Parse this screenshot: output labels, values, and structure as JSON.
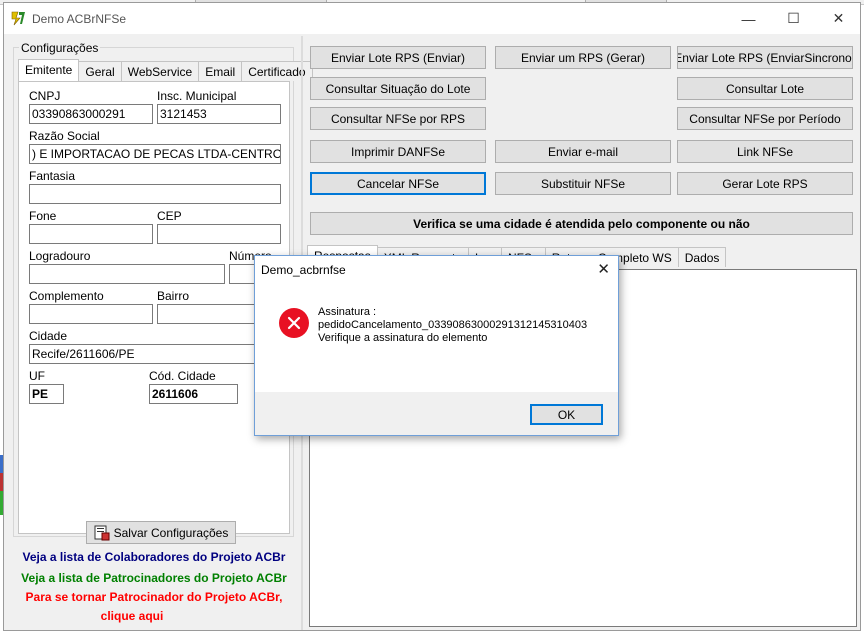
{
  "window": {
    "title": "Demo ACBrNFSe",
    "minimize_symbol": "—",
    "maximize_symbol": "☐",
    "close_symbol": "✕",
    "icon": "app-logo-icon"
  },
  "config": {
    "group_label": "Configurações",
    "tabs": [
      "Emitente",
      "Geral",
      "WebService",
      "Email",
      "Certificado"
    ],
    "active_tab": "Emitente",
    "fields": {
      "cnpj_label": "CNPJ",
      "cnpj_value": "03390863000291",
      "im_label": "Insc. Municipal",
      "im_value": "3121453",
      "razao_label": "Razão Social",
      "razao_value": ") E IMPORTACAO DE PECAS LTDA-CENTROCAR",
      "fantasia_label": "Fantasia",
      "fantasia_value": "",
      "fone_label": "Fone",
      "fone_value": "",
      "cep_label": "CEP",
      "cep_value": "",
      "logradouro_label": "Logradouro",
      "logradouro_value": "",
      "numero_label": "Número",
      "numero_value": "",
      "complemento_label": "Complemento",
      "complemento_value": "",
      "bairro_label": "Bairro",
      "bairro_value": "",
      "cidade_label": "Cidade",
      "cidade_value": "Recife/2611606/PE",
      "uf_label": "UF",
      "uf_value": "PE",
      "cod_cidade_label": "Cód. Cidade",
      "cod_cidade_value": "2611606"
    },
    "save_button": "Salvar Configurações",
    "save_icon": "save-config-icon"
  },
  "links": {
    "colaboradores": "Veja a lista de Colaboradores do Projeto ACBr",
    "patrocinadores": "Veja a lista de Patrocinadores do Projeto ACBr",
    "tornar_patrocinador_1": "Para se tornar Patrocinador do Projeto ACBr,",
    "tornar_patrocinador_2": "clique aqui",
    "colors": {
      "colaboradores": "#000080",
      "patrocinadores": "#008000",
      "tornar": "#ff0000"
    }
  },
  "actions": {
    "enviar_lote": "Enviar Lote RPS (Enviar)",
    "enviar_um": "Enviar um RPS (Gerar)",
    "enviar_sincrono": "Enviar Lote RPS (EnviarSincrono)",
    "consultar_situacao": "Consultar Situação do Lote",
    "consultar_lote": "Consultar Lote",
    "consultar_por_rps": "Consultar NFSe por RPS",
    "consultar_por_periodo": "Consultar NFSe por Período",
    "imprimir_danfse": "Imprimir DANFSe",
    "enviar_email": "Enviar e-mail",
    "link_nfse": "Link NFSe",
    "cancelar_nfse": "Cancelar NFSe",
    "substituir_nfse": "Substituir NFSe",
    "gerar_lote": "Gerar Lote RPS",
    "verifica_cidade": "Verifica se uma cidade é atendida pelo componente ou não"
  },
  "response_tabs": [
    "Respostas",
    "XML Resposta",
    "Log",
    "NFSe",
    "Retorno Completo WS",
    "Dados"
  ],
  "dialog": {
    "title": "Demo_acbrnfse",
    "close_symbol": "✕",
    "icon": "error-icon",
    "line1": "Assinatura :",
    "line2": "pedidoCancelamento_033908630002913121453104​03",
    "line3": "Verifique a assinatura do elemento",
    "ok_label": "OK"
  }
}
